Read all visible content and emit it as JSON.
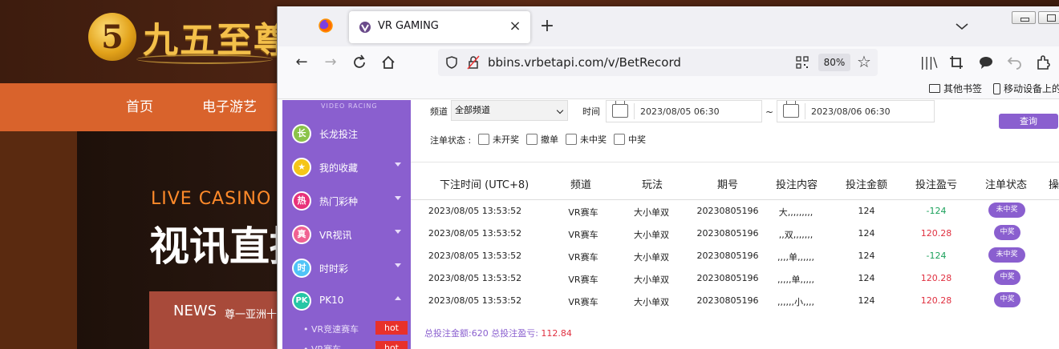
{
  "background_site": {
    "logo_mark": "5",
    "logo_text": "九五至尊",
    "nav": [
      "首页",
      "电子游艺"
    ],
    "hero_tag": "LIVE CASINO",
    "hero_title": "视讯直播",
    "news_tag": "NEWS",
    "news_text": "尊一亚洲十"
  },
  "browser": {
    "tab": {
      "title": "VR GAMING",
      "close": "×"
    },
    "new_tab": "+",
    "url": "bbins.vrbetapi.com/v/BetRecord",
    "zoom": "80%",
    "bookmarks": [
      "其他书签",
      "移动设备上的"
    ]
  },
  "sidebar": {
    "brand": "VIDEO RACING",
    "items": [
      {
        "icon": "长",
        "label": "长龙投注",
        "arrow": ""
      },
      {
        "icon": "★",
        "label": "我的收藏",
        "arrow": "down"
      },
      {
        "icon": "热",
        "label": "热门彩种",
        "arrow": "down"
      },
      {
        "icon": "真",
        "label": "VR视讯",
        "arrow": "down"
      },
      {
        "icon": "时",
        "label": "时时彩",
        "arrow": "down"
      },
      {
        "icon": "PK",
        "label": "PK10",
        "arrow": "up"
      }
    ],
    "sub_items": [
      {
        "label": "• VR竞速赛车",
        "badge": "hot"
      },
      {
        "label": "• VR赛车",
        "badge": "hot"
      }
    ],
    "colors": {
      "bg": "#8a5fcf",
      "hot": "#e8312a"
    }
  },
  "filters": {
    "channel_label": "频道",
    "channel_value": "全部频道",
    "time_label": "时间",
    "start_time": "2023/08/05 06:30",
    "range_sep": "~",
    "end_time": "2023/08/06 06:30",
    "query_button": "查询",
    "status_label": "注单状态 :",
    "status_options": [
      "未开奖",
      "撤单",
      "未中奖",
      "中奖"
    ]
  },
  "table": {
    "headers": [
      "下注时间 (UTC+8)",
      "频道",
      "玩法",
      "期号",
      "投注内容",
      "投注金额",
      "投注盈亏",
      "注单状态",
      "操"
    ],
    "rows": [
      {
        "time": "2023/08/05 13:53:52",
        "channel": "VR赛车",
        "play": "大小单双",
        "issue": "20230805196",
        "content": "大,,,,,,,,,",
        "amount": "124",
        "pl": "-124",
        "status": "未中奖"
      },
      {
        "time": "2023/08/05 13:53:52",
        "channel": "VR赛车",
        "play": "大小单双",
        "issue": "20230805196",
        "content": ",,双,,,,,,,",
        "amount": "124",
        "pl": "120.28",
        "status": "中奖"
      },
      {
        "time": "2023/08/05 13:53:52",
        "channel": "VR赛车",
        "play": "大小单双",
        "issue": "20230805196",
        "content": ",,,,单,,,,,,",
        "amount": "124",
        "pl": "-124",
        "status": "未中奖"
      },
      {
        "time": "2023/08/05 13:53:52",
        "channel": "VR赛车",
        "play": "大小单双",
        "issue": "20230805196",
        "content": ",,,,,单,,,,,",
        "amount": "124",
        "pl": "120.28",
        "status": "中奖"
      },
      {
        "time": "2023/08/05 13:53:52",
        "channel": "VR赛车",
        "play": "大小单双",
        "issue": "20230805196",
        "content": ",,,,,,小,,,,",
        "amount": "124",
        "pl": "120.28",
        "status": "中奖"
      }
    ]
  },
  "summary": {
    "total_label": "总投注金额:620 总投注盈亏:",
    "total_pl": "112.84"
  }
}
